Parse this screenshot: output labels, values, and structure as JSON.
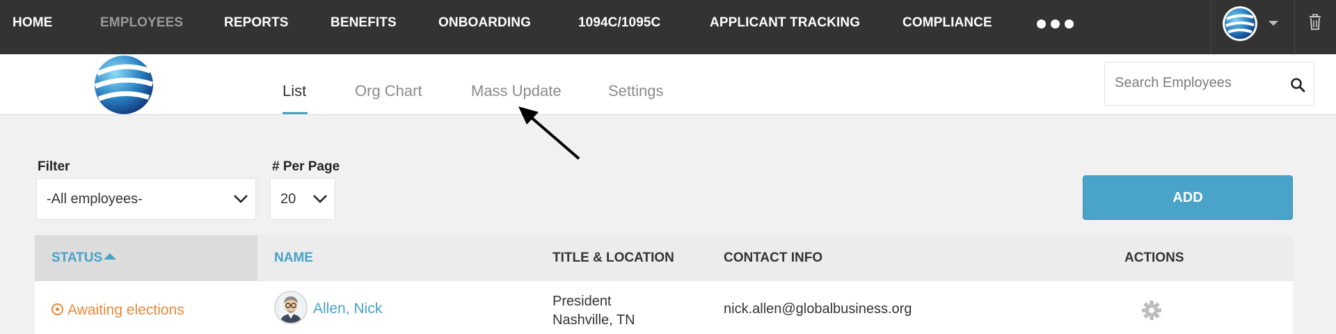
{
  "nav": {
    "items": [
      {
        "label": "HOME",
        "active": false
      },
      {
        "label": "EMPLOYEES",
        "active": true
      },
      {
        "label": "REPORTS",
        "active": false
      },
      {
        "label": "BENEFITS",
        "active": false
      },
      {
        "label": "ONBOARDING",
        "active": false
      },
      {
        "label": "1094C/1095C",
        "active": false
      },
      {
        "label": "APPLICANT TRACKING",
        "active": false
      },
      {
        "label": "COMPLIANCE",
        "active": false
      }
    ],
    "more_icon": "more-dots-icon",
    "avatar_icon": "globe-logo-icon",
    "dropdown_icon": "caret-down-icon",
    "trash_icon": "trash-icon",
    "bg_color": "#333333"
  },
  "subnav": {
    "logo_icon": "globe-logo-icon",
    "tabs": [
      {
        "label": "List",
        "active": true
      },
      {
        "label": "Org Chart",
        "active": false
      },
      {
        "label": "Mass Update",
        "active": false
      },
      {
        "label": "Settings",
        "active": false
      }
    ],
    "search": {
      "placeholder": "Search Employees",
      "value": "",
      "icon": "search-icon"
    }
  },
  "filters": {
    "filter_label": "Filter",
    "filter_value": "-All employees-",
    "per_page_label": "# Per Page",
    "per_page_value": "20"
  },
  "add_button": {
    "label": "ADD",
    "color": "#4aa3c9"
  },
  "table": {
    "headers": {
      "status": "STATUS",
      "name": "NAME",
      "title_location": "TITLE & LOCATION",
      "contact": "CONTACT INFO",
      "actions": "ACTIONS"
    },
    "sort": {
      "column": "status",
      "direction": "ascending"
    },
    "rows": [
      {
        "status": "Awaiting elections",
        "status_color": "#e8883a",
        "name": "Allen, Nick",
        "title": "President",
        "location": "Nashville, TN",
        "email": "nick.allen@globalbusiness.org",
        "action_icon": "gear-icon"
      }
    ]
  },
  "accent_color": "#48a1c7"
}
